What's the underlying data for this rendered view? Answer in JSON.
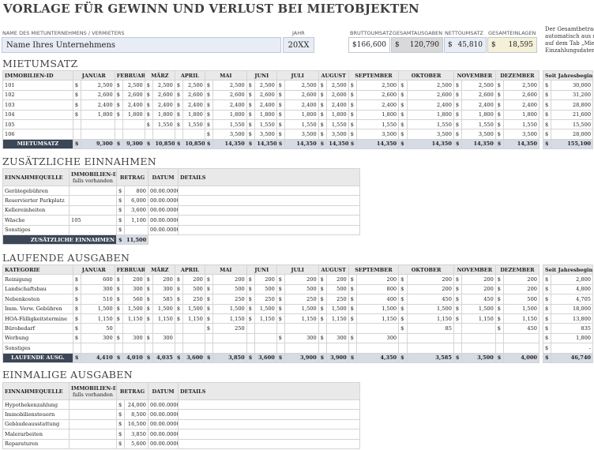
{
  "title": "VORLAGE FÜR GEWINN UND VERLUST BEI MIETOBJEKTEN",
  "header": {
    "company_label": "NAME DES MIETUNTERNEHMENS / VERMIETERS",
    "company_value": "Name Ihres Unternehmens",
    "year_label": "JAHR",
    "year_value": "20XX",
    "gross_label": "BRUTTOUMSATZ",
    "gross_value": "166,600",
    "expenses_label": "GESAMTAUSGABEN",
    "expenses_value": "120,790",
    "net_label": "NETTOUMSATZ",
    "net_value": "45,810",
    "deposits_label": "GESAMTEINLAGEN",
    "deposits_value": "18,595",
    "currency": "$",
    "side_note": [
      "Der Gesamtbetrag d",
      "automatisch aus der",
      "auf dem Tab „Miete",
      "Einzahlungsdaten“ e"
    ]
  },
  "colors": {
    "header_bg": "#e8edf5",
    "total_label_bg": "#3b4656",
    "expenses_bg": "#d9d9d9",
    "net_bg": "#e8edf5",
    "deposits_bg": "#f5f0d8"
  },
  "rent": {
    "section": "MIETUMSATZ",
    "columns": [
      "IMMOBILIEN-ID",
      "JANUAR",
      "FEBRUAR",
      "MÄRZ",
      "APRIL",
      "MAI",
      "JUNI",
      "JULI",
      "AUGUST",
      "SEPTEMBER",
      "OKTOBER",
      "NOVEMBER",
      "DEZEMBER"
    ],
    "ytd_label": "Seit Jahresbeginn",
    "rows": [
      {
        "id": "101",
        "v": [
          "2,500",
          "2,500",
          "2,500",
          "2,500",
          "2,500",
          "2,500",
          "2,500",
          "2,500",
          "2,500",
          "2,500",
          "2,500",
          "2,500"
        ],
        "ytd": "30,000"
      },
      {
        "id": "102",
        "v": [
          "2,600",
          "2,600",
          "2,600",
          "2,600",
          "2,600",
          "2,600",
          "2,600",
          "2,600",
          "2,600",
          "2,600",
          "2,600",
          "2,600"
        ],
        "ytd": "31,200"
      },
      {
        "id": "103",
        "v": [
          "2,400",
          "2,400",
          "2,400",
          "2,400",
          "2,400",
          "2,400",
          "2,400",
          "2,400",
          "2,400",
          "2,400",
          "2,400",
          "2,400"
        ],
        "ytd": "28,800"
      },
      {
        "id": "104",
        "v": [
          "1,800",
          "1,800",
          "1,800",
          "1,800",
          "1,800",
          "1,800",
          "1,800",
          "1,800",
          "1,800",
          "1,800",
          "1,800",
          "1,800"
        ],
        "ytd": "21,600"
      },
      {
        "id": "105",
        "v": [
          "",
          "",
          "1,550",
          "1,550",
          "1,550",
          "1,550",
          "1,550",
          "1,550",
          "1,550",
          "1,550",
          "1,550",
          "1,550"
        ],
        "ytd": "15,500"
      },
      {
        "id": "106",
        "v": [
          "",
          "",
          "",
          "",
          "3,500",
          "3,500",
          "3,500",
          "3,500",
          "3,500",
          "3,500",
          "3,500",
          "3,500"
        ],
        "ytd": "28,000"
      }
    ],
    "total_label": "MIETUMSATZ",
    "totals": [
      "9,300",
      "9,300",
      "10,850",
      "10,850",
      "14,350",
      "14,350",
      "14,350",
      "14,350",
      "14,350",
      "14,350",
      "14,350",
      "14,350"
    ],
    "total_ytd": "155,100"
  },
  "extra": {
    "section": "ZUSÄTZLICHE EINNAHMEN",
    "columns": [
      "EINNAHMEQUELLE",
      "IMMOBILIEN-ID,",
      "falls vorhanden",
      "BETRAG",
      "DATUM",
      "DETAILS"
    ],
    "rows": [
      {
        "src": "Gerätegebühren",
        "id": "",
        "amt": "800",
        "date": "00.00.0000"
      },
      {
        "src": "Reservierter Parkplatz",
        "id": "",
        "amt": "6,000",
        "date": "00.00.0000"
      },
      {
        "src": "Kellereinheiten",
        "id": "",
        "amt": "3,600",
        "date": "00.00.0000"
      },
      {
        "src": "Wäsche",
        "id": "105",
        "amt": "1,100",
        "date": "00.00.0000"
      },
      {
        "src": "Sonstiges",
        "id": "",
        "amt": "",
        "date": "00.00.0000"
      }
    ],
    "total_label": "ZUSÄTZLICHE EINNAHMEN",
    "total": "11,500"
  },
  "running": {
    "section": "LAUFENDE AUSGABEN",
    "columns": [
      "KATEGORIE",
      "JANUAR",
      "FEBRUAR",
      "MÄRZ",
      "APRIL",
      "MAI",
      "JUNI",
      "JULI",
      "AUGUST",
      "SEPTEMBER",
      "OKTOBER",
      "NOVEMBER",
      "DEZEMBER"
    ],
    "ytd_label": "Seit Jahresbeginn",
    "rows": [
      {
        "id": "Reinigung",
        "v": [
          "600",
          "200",
          "200",
          "200",
          "200",
          "200",
          "200",
          "200",
          "200",
          "200",
          "200",
          "200"
        ],
        "ytd": "2,800"
      },
      {
        "id": "Landschaftsbau",
        "v": [
          "300",
          "300",
          "300",
          "500",
          "500",
          "500",
          "500",
          "500",
          "800",
          "200",
          "200",
          "200"
        ],
        "ytd": "4,800"
      },
      {
        "id": "Nebenkosten",
        "v": [
          "510",
          "560",
          "585",
          "250",
          "250",
          "250",
          "250",
          "250",
          "400",
          "450",
          "450",
          "500"
        ],
        "ytd": "4,705"
      },
      {
        "id": "Imm. Verw. Gebühren",
        "v": [
          "1,500",
          "1,500",
          "1,500",
          "1,500",
          "1,500",
          "1,500",
          "1,500",
          "1,500",
          "1,500",
          "1,500",
          "1,500",
          "1,500"
        ],
        "ytd": "18,000"
      },
      {
        "id": "HOA-Fälligkeitstermine",
        "v": [
          "1,150",
          "1,150",
          "1,150",
          "1,150",
          "1,150",
          "1,150",
          "1,150",
          "1,150",
          "1,150",
          "1,150",
          "1,150",
          "1,150"
        ],
        "ytd": "13,800"
      },
      {
        "id": "Bürobedarf",
        "v": [
          "50",
          "",
          "",
          "",
          "250",
          "",
          "",
          "",
          "",
          "85",
          "",
          "450"
        ],
        "ytd": "835"
      },
      {
        "id": "Werbung",
        "v": [
          "300",
          "300",
          "300",
          "",
          "",
          "",
          "300",
          "300",
          "300",
          "",
          "",
          ""
        ],
        "ytd": "1,800"
      },
      {
        "id": "Sonstiges",
        "v": [
          "",
          "",
          "",
          "",
          "",
          "",
          "",
          "",
          "",
          "",
          "",
          ""
        ],
        "ytd": "-"
      }
    ],
    "total_label": "LAUFENDE AUSG.",
    "totals": [
      "4,410",
      "4,010",
      "4,035",
      "3,600",
      "3,850",
      "3,600",
      "3,900",
      "3,900",
      "4,350",
      "3,585",
      "3,500",
      "4,000"
    ],
    "total_ytd": "46,740"
  },
  "oneoff": {
    "section": "EINMALIGE AUSGABEN",
    "columns": [
      "EINNAHMEQUELLE",
      "IMMOBILIEN-ID,",
      "falls vorhanden",
      "BETRAG",
      "DATUM",
      "DETAILS"
    ],
    "rows": [
      {
        "src": "Hypothekenzahlung",
        "id": "",
        "amt": "24,000",
        "date": "00.00.0000"
      },
      {
        "src": "Immobiliensteuern",
        "id": "",
        "amt": "8,500",
        "date": "00.00.0000"
      },
      {
        "src": "Gebäudeausstattung",
        "id": "",
        "amt": "16,500",
        "date": "00.00.0000"
      },
      {
        "src": "Malerarbeiten",
        "id": "",
        "amt": "3,850",
        "date": "00.00.0000"
      },
      {
        "src": "Reparaturen",
        "id": "",
        "amt": "5,600",
        "date": "00.00.0000"
      }
    ]
  }
}
